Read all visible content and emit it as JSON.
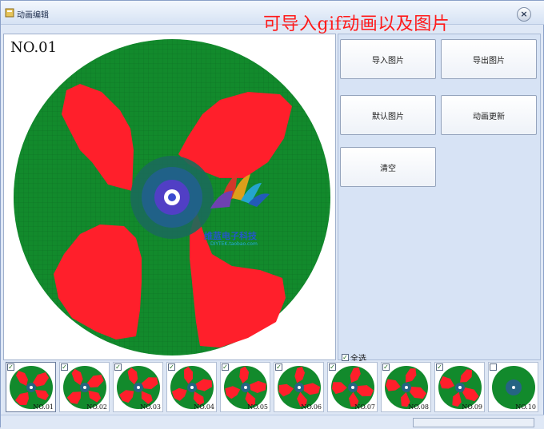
{
  "window": {
    "title": "动画编辑",
    "overlay_text": "可导入gif动画以及图片",
    "close_glyph": "×"
  },
  "canvas": {
    "frame_label": "NO.01",
    "watermark_text": "维蓝电子科技",
    "watermark_subtext": "DIYTEK.taobao.com"
  },
  "buttons": {
    "import": "导入图片",
    "export": "导出图片",
    "default": "默认图片",
    "update": "动画更新",
    "clear": "清空"
  },
  "select_all": {
    "label": "全选",
    "checked": true
  },
  "frames": [
    {
      "label": "NO.01",
      "checked": true,
      "empty": false
    },
    {
      "label": "NO.02",
      "checked": true,
      "empty": false
    },
    {
      "label": "NO.03",
      "checked": true,
      "empty": false
    },
    {
      "label": "NO.04",
      "checked": true,
      "empty": false
    },
    {
      "label": "NO.05",
      "checked": true,
      "empty": false
    },
    {
      "label": "NO.06",
      "checked": true,
      "empty": false
    },
    {
      "label": "NO.07",
      "checked": true,
      "empty": false
    },
    {
      "label": "NO.08",
      "checked": true,
      "empty": false
    },
    {
      "label": "NO.09",
      "checked": true,
      "empty": false
    },
    {
      "label": "NO.10",
      "checked": false,
      "empty": true
    }
  ],
  "colors": {
    "disc_green": "#128a2c",
    "blade_red": "#ff1f2b",
    "overlay_red": "#ff1a1a"
  }
}
